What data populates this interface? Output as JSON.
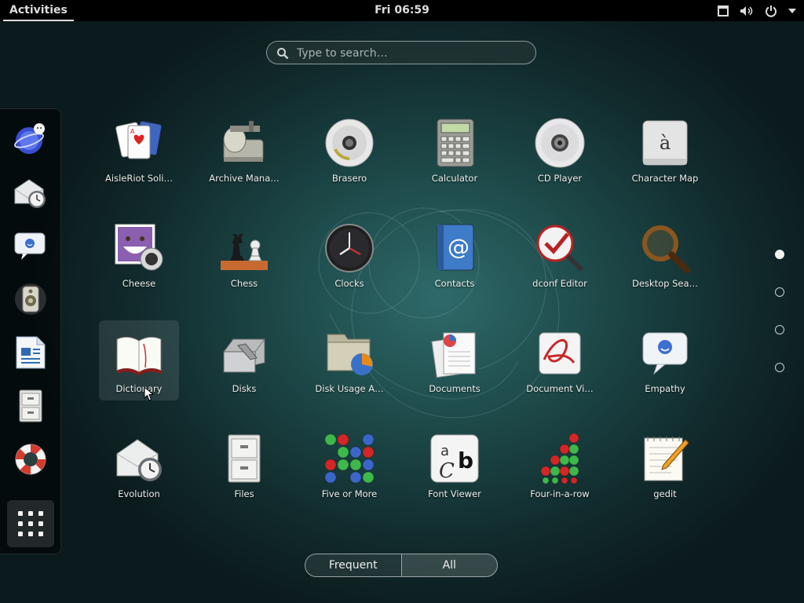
{
  "topbar": {
    "activities": "Activities",
    "clock": "Fri 06:59",
    "icons": [
      "window-icon",
      "volume-icon",
      "power-icon",
      "menu-arrow-icon"
    ]
  },
  "search": {
    "placeholder": "Type to search…"
  },
  "dash": {
    "items": [
      "empathy",
      "evolution",
      "chat",
      "speaker",
      "writer",
      "files",
      "help",
      "show-apps"
    ]
  },
  "apps": [
    {
      "label": "AisleRiot Soli…",
      "icon": "cards-icon"
    },
    {
      "label": "Archive Mana…",
      "icon": "archive-icon"
    },
    {
      "label": "Brasero",
      "icon": "disc-burner-icon"
    },
    {
      "label": "Calculator",
      "icon": "calculator-icon"
    },
    {
      "label": "CD Player",
      "icon": "cd-icon"
    },
    {
      "label": "Character Map",
      "icon": "character-map-icon"
    },
    {
      "label": "Cheese",
      "icon": "cheese-icon"
    },
    {
      "label": "Chess",
      "icon": "chess-icon"
    },
    {
      "label": "Clocks",
      "icon": "clock-icon"
    },
    {
      "label": "Contacts",
      "icon": "contacts-icon"
    },
    {
      "label": "dconf Editor",
      "icon": "dconf-icon"
    },
    {
      "label": "Desktop Sea…",
      "icon": "magnifier-icon"
    },
    {
      "label": "Dictionary",
      "icon": "book-icon"
    },
    {
      "label": "Disks",
      "icon": "disk-icon"
    },
    {
      "label": "Disk Usage A…",
      "icon": "disk-usage-icon"
    },
    {
      "label": "Documents",
      "icon": "documents-icon"
    },
    {
      "label": "Document Vi…",
      "icon": "document-viewer-icon"
    },
    {
      "label": "Empathy",
      "icon": "empathy-icon"
    },
    {
      "label": "Evolution",
      "icon": "evolution-icon"
    },
    {
      "label": "Files",
      "icon": "files-icon"
    },
    {
      "label": "Five or More",
      "icon": "five-or-more-icon"
    },
    {
      "label": "Font Viewer",
      "icon": "font-viewer-icon"
    },
    {
      "label": "Four-in-a-row",
      "icon": "four-in-a-row-icon"
    },
    {
      "label": "gedit",
      "icon": "gedit-icon"
    }
  ],
  "pages": {
    "count": 4,
    "active": 1
  },
  "toggle": {
    "frequent": "Frequent",
    "all": "All",
    "selected": "All"
  },
  "colors": {
    "topbar": "#000000",
    "accent": "#dcdcdc",
    "bg": "#1d4848"
  }
}
